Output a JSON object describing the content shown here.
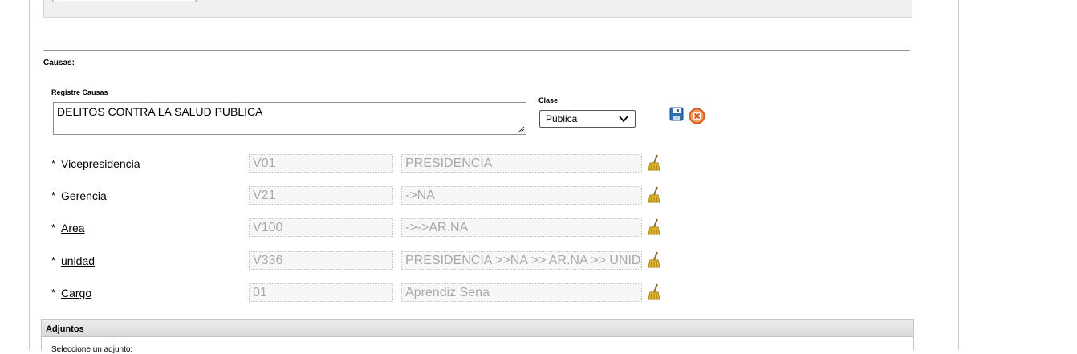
{
  "causas": {
    "section_title": "Causas:",
    "input_label": "Registre Causas",
    "input_value": "DELITOS CONTRA LA SALUD PUBLICA",
    "clase_label": "Clase",
    "clase_selected": "Pública"
  },
  "fields": [
    {
      "required": "*",
      "label": "Vicepresidencia",
      "code": "V01",
      "description": "PRESIDENCIA"
    },
    {
      "required": "*",
      "label": "Gerencia",
      "code": "V21",
      "description": "->NA"
    },
    {
      "required": "*",
      "label": "Area",
      "code": "V100",
      "description": "->->AR.NA"
    },
    {
      "required": "*",
      "label": "unidad",
      "code": "V336",
      "description": " PRESIDENCIA >>NA >> AR.NA >>  UNIDAD"
    },
    {
      "required": "*",
      "label": "Cargo",
      "code": "01",
      "description": "Aprendiz Sena"
    }
  ],
  "adjuntos": {
    "title": "Adjuntos",
    "subtitle": "Seleccione un adjunto:"
  },
  "icons": {
    "save": "save-icon",
    "cancel": "cancel-icon",
    "clear": "broom-icon"
  },
  "colors": {
    "save_blue": "#2f6fb5",
    "cancel_orange": "#e8702a",
    "broom_yellow": "#e5b82a"
  }
}
